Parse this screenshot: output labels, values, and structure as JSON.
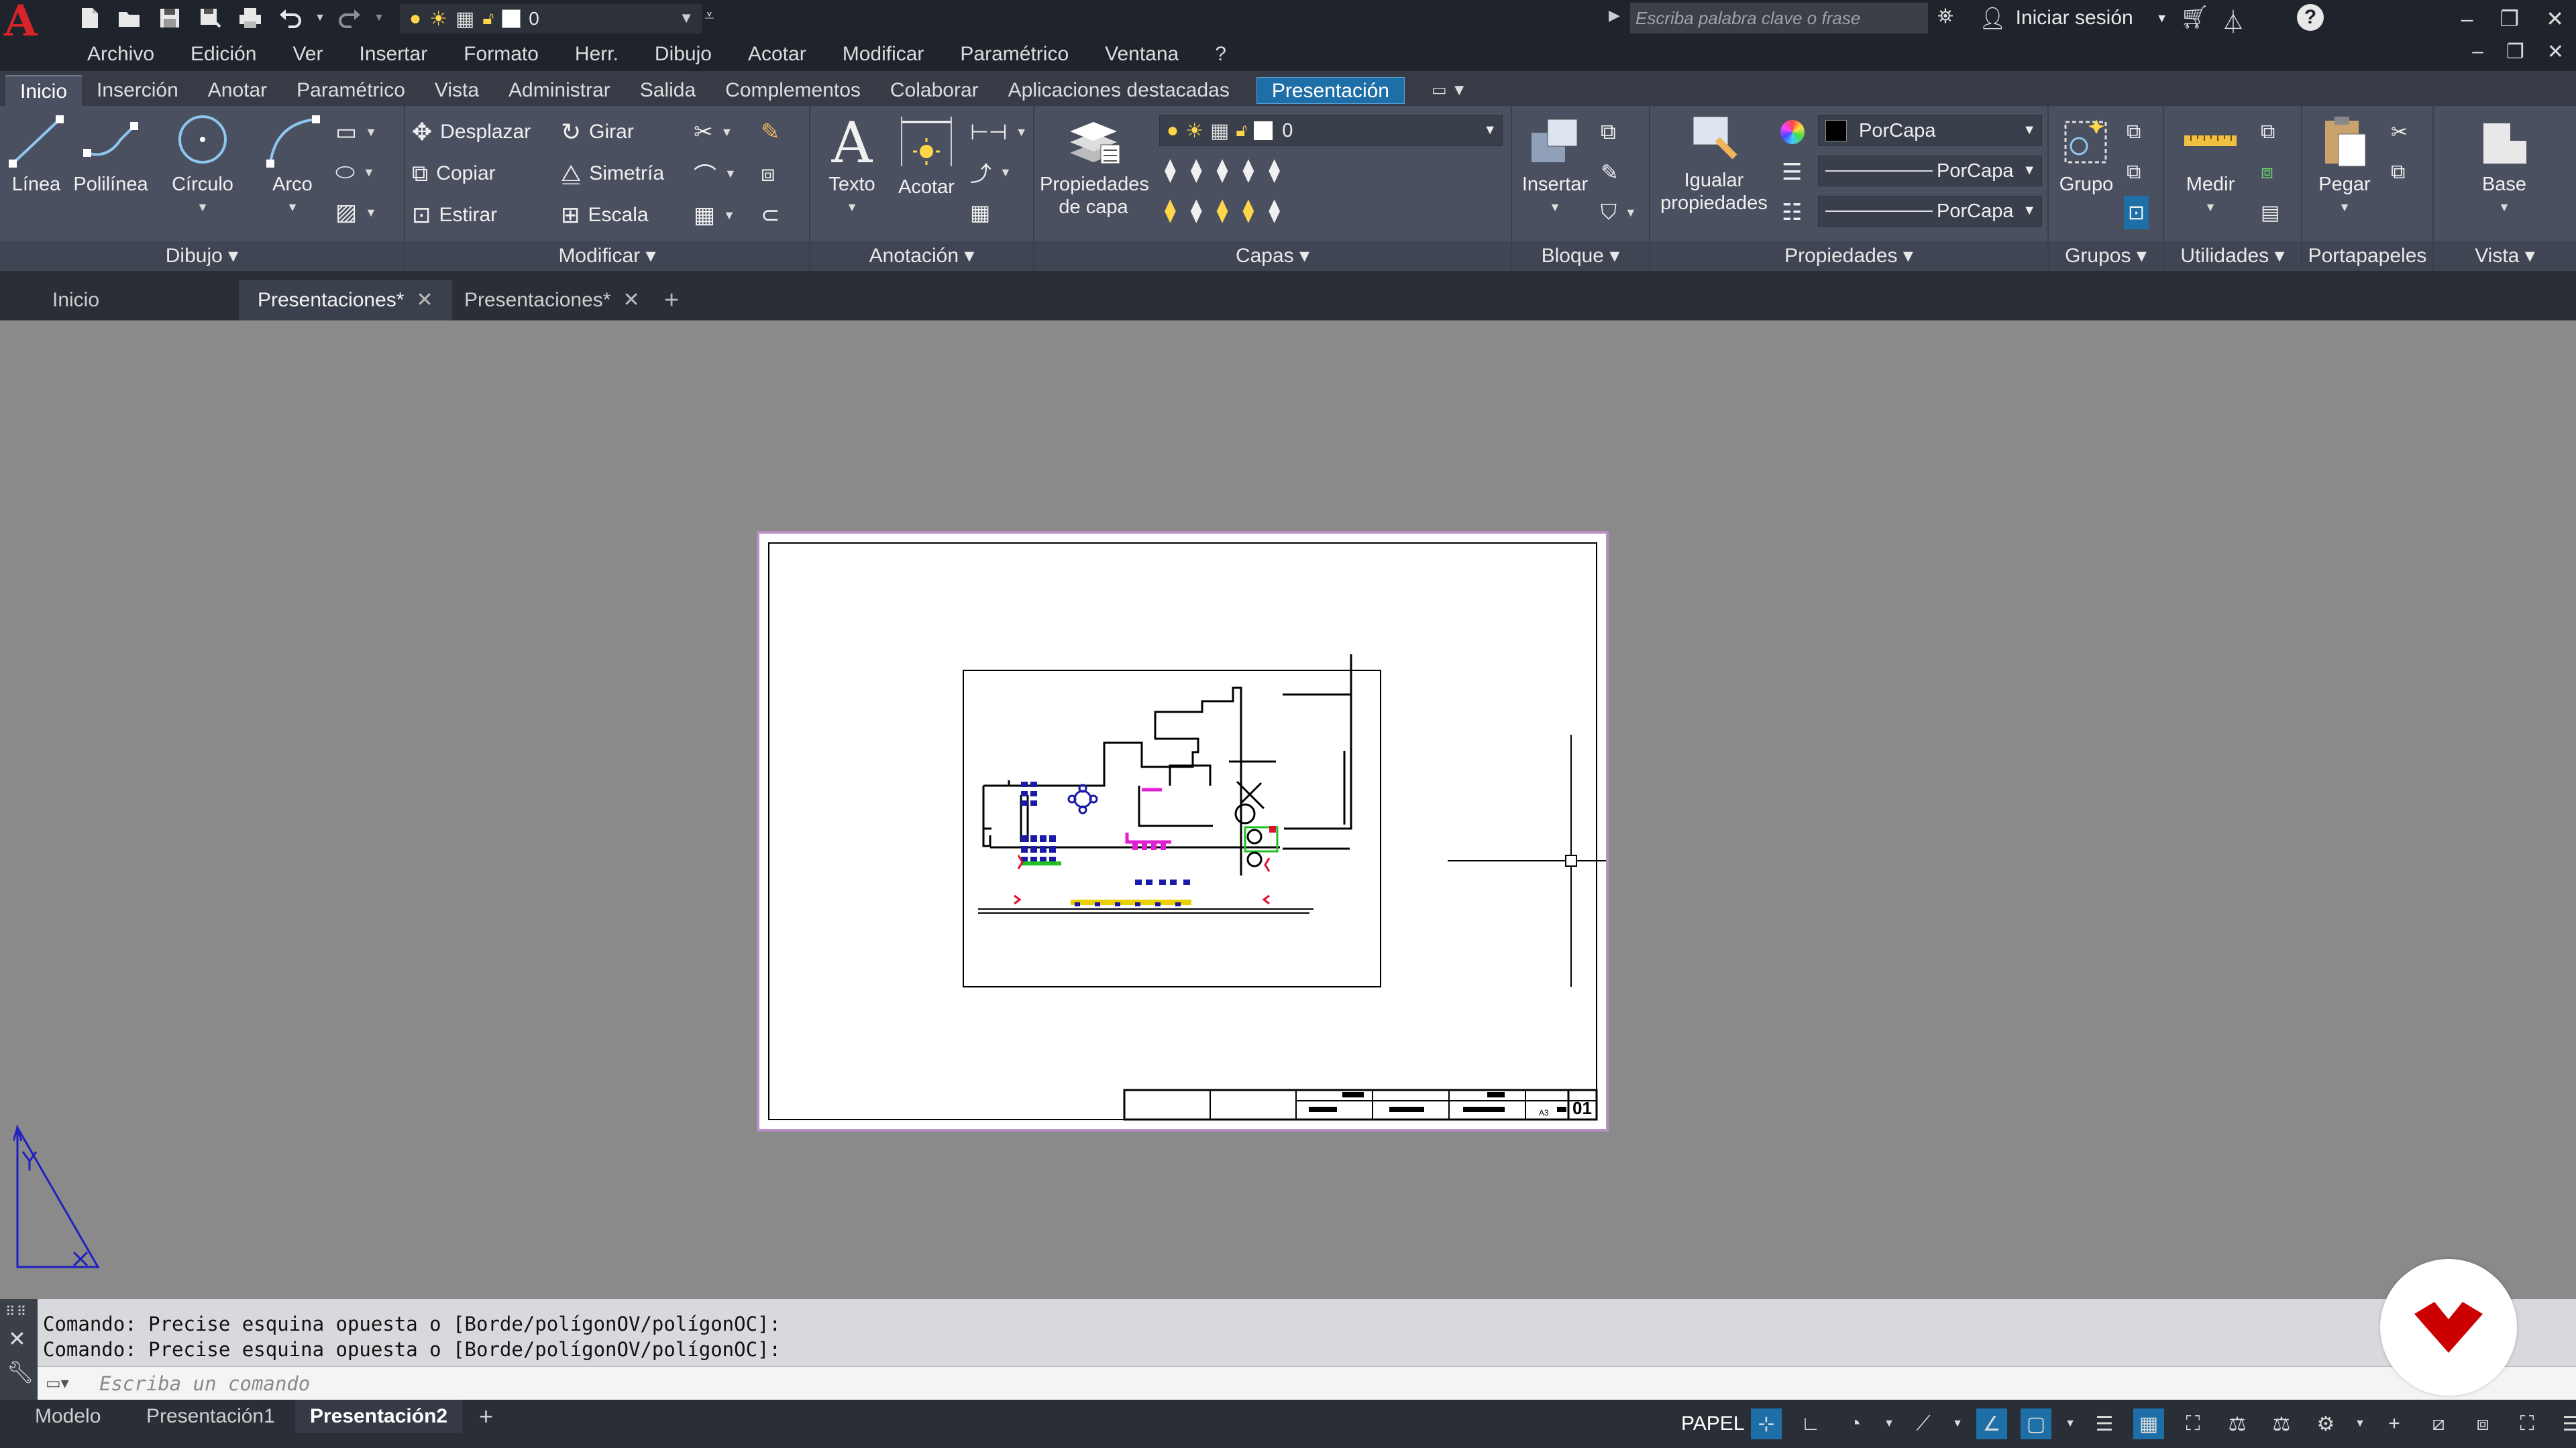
{
  "menu": [
    "Archivo",
    "Edición",
    "Ver",
    "Insertar",
    "Formato",
    "Herr.",
    "Dibujo",
    "Acotar",
    "Modificar",
    "Paramétrico",
    "Ventana",
    "?"
  ],
  "quick_access": {
    "layer_value": "0"
  },
  "search": {
    "placeholder": "Escriba palabra clave o frase"
  },
  "signin": {
    "label": "Iniciar sesión"
  },
  "ribbon_tabs": [
    "Inicio",
    "Inserción",
    "Anotar",
    "Paramétrico",
    "Vista",
    "Administrar",
    "Salida",
    "Complementos",
    "Colaborar",
    "Aplicaciones destacadas"
  ],
  "ribbon_active_tab": "Presentación",
  "panels": {
    "dibujo": {
      "title": "Dibujo",
      "linea": "Línea",
      "polilinea": "Polilínea",
      "circulo": "Círculo",
      "arco": "Arco"
    },
    "modificar": {
      "title": "Modificar",
      "desplazar": "Desplazar",
      "girar": "Girar",
      "copiar": "Copiar",
      "simetria": "Simetría",
      "estirar": "Estirar",
      "escala": "Escala"
    },
    "anotacion": {
      "title": "Anotación",
      "texto": "Texto",
      "acotar": "Acotar"
    },
    "capas": {
      "title": "Capas",
      "prop_line1": "Propiedades",
      "prop_line2": "de capa",
      "layer_value": "0"
    },
    "bloque": {
      "title": "Bloque",
      "insertar": "Insertar"
    },
    "propiedades": {
      "title": "Propiedades",
      "igualar_line1": "Igualar",
      "igualar_line2": "propiedades",
      "color": "PorCapa",
      "linetype": "PorCapa",
      "lineweight": "PorCapa"
    },
    "grupos": {
      "title": "Grupos",
      "grupo": "Grupo"
    },
    "utilidades": {
      "title": "Utilidades",
      "medir": "Medir"
    },
    "portapapeles": {
      "title": "Portapapeles",
      "pegar": "Pegar"
    },
    "vista": {
      "title": "Vista",
      "base": "Base"
    }
  },
  "file_tabs": [
    "Inicio",
    "Presentaciones*",
    "Presentaciones*"
  ],
  "command": {
    "history": [
      "Comando: Precise esquina opuesta o [Borde/polígonOV/polígonOC]:",
      "Comando: Precise esquina opuesta o [Borde/polígonOV/polígonOC]:"
    ],
    "placeholder": "Escriba un comando"
  },
  "layout_tabs": [
    "Modelo",
    "Presentación1",
    "Presentación2"
  ],
  "layout_active": "Presentación2",
  "status": {
    "space": "PAPEL"
  },
  "title_block": {
    "sheet_no": "01",
    "size": "A3"
  },
  "colors": {
    "accent": "#1e6fa8",
    "logo": "#d5242a",
    "sheet_border": "#b98fc4",
    "brand": "#cc0000"
  }
}
